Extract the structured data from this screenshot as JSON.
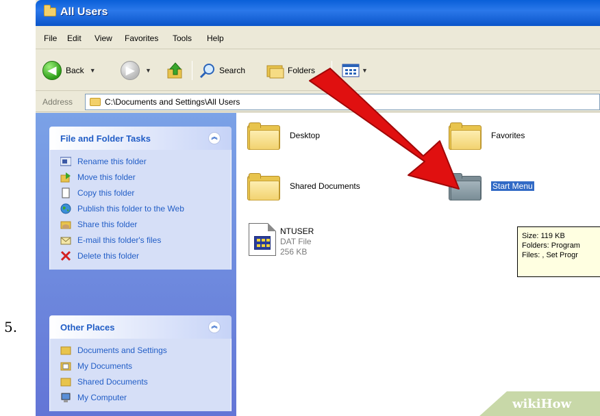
{
  "step_label": "5.",
  "window": {
    "title": "All Users"
  },
  "menu": [
    "File",
    "Edit",
    "View",
    "Favorites",
    "Tools",
    "Help"
  ],
  "toolbar": {
    "back": "Back",
    "search": "Search",
    "folders": "Folders"
  },
  "address": {
    "label": "Address",
    "path": "C:\\Documents and Settings\\All Users"
  },
  "file_folder_tasks": {
    "title": "File and Folder Tasks",
    "items": [
      {
        "label": "Rename this folder",
        "icon": "rename-icon"
      },
      {
        "label": "Move this folder",
        "icon": "move-icon"
      },
      {
        "label": "Copy this folder",
        "icon": "copy-icon"
      },
      {
        "label": "Publish this folder to the Web",
        "icon": "globe-icon"
      },
      {
        "label": "Share this folder",
        "icon": "share-icon"
      },
      {
        "label": "E-mail this folder's files",
        "icon": "email-icon"
      },
      {
        "label": "Delete this folder",
        "icon": "delete-icon"
      }
    ]
  },
  "other_places": {
    "title": "Other Places",
    "items": [
      {
        "label": "Documents and Settings",
        "icon": "folder-icon"
      },
      {
        "label": "My Documents",
        "icon": "my-documents-icon"
      },
      {
        "label": "Shared Documents",
        "icon": "folder-icon"
      },
      {
        "label": "My Computer",
        "icon": "computer-icon"
      }
    ]
  },
  "files": {
    "desktop": "Desktop",
    "favorites": "Favorites",
    "shared_documents": "Shared Documents",
    "start_menu": "Start Menu",
    "ntuser": {
      "name": "NTUSER",
      "type": "DAT File",
      "size": "256 KB"
    }
  },
  "tooltip": {
    "size": "Size: 119 KB",
    "folders": "Folders: Program",
    "files": "Files: , Set Progr"
  },
  "watermark": {
    "prefix": "wiki",
    "suffix": "How"
  },
  "colors": {
    "arrow": "#e01010",
    "selection": "#316ac5",
    "task_link": "#215dc6"
  }
}
